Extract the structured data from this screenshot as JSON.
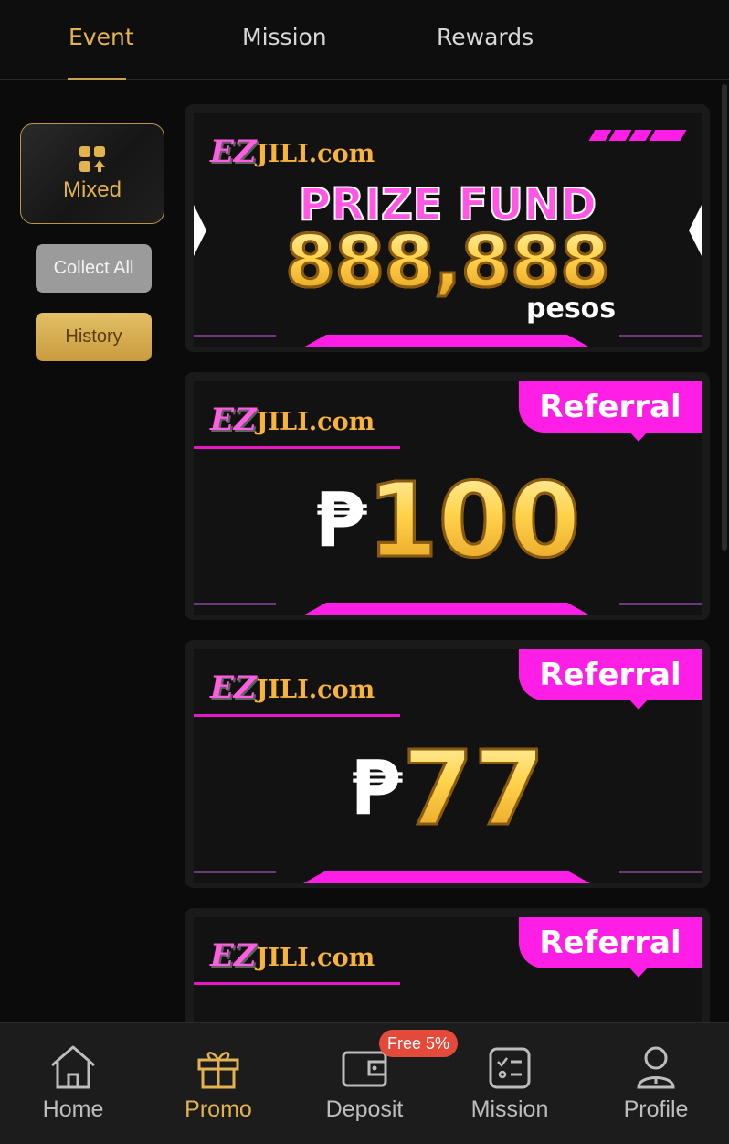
{
  "tabs": [
    {
      "label": "Event",
      "active": true
    },
    {
      "label": "Mission",
      "active": false
    },
    {
      "label": "Rewards",
      "active": false
    }
  ],
  "sidebar": {
    "filter_label": "Mixed",
    "filter_icon": "cards-suits-icon",
    "collect_all_label": "Collect All",
    "history_label": "History"
  },
  "cards": [
    {
      "type": "prize",
      "logo_ez": "EZ",
      "logo_rest": "JILI.com",
      "title": "PRIZE FUND",
      "amount": "888,888",
      "unit": "pesos"
    },
    {
      "type": "referral",
      "logo_ez": "EZ",
      "logo_rest": "JILI.com",
      "badge": "Referral",
      "currency": "₱",
      "amount": "100"
    },
    {
      "type": "referral",
      "logo_ez": "EZ",
      "logo_rest": "JILI.com",
      "badge": "Referral",
      "currency": "₱",
      "amount": "77"
    },
    {
      "type": "referral",
      "logo_ez": "EZ",
      "logo_rest": "JILI.com",
      "badge": "Referral"
    }
  ],
  "nav": {
    "items": [
      {
        "label": "Home",
        "icon": "home-icon",
        "active": false
      },
      {
        "label": "Promo",
        "icon": "gift-icon",
        "active": true
      },
      {
        "label": "Deposit",
        "icon": "wallet-icon",
        "active": false
      },
      {
        "label": "Mission",
        "icon": "checklist-icon",
        "active": false
      },
      {
        "label": "Profile",
        "icon": "user-icon",
        "active": false
      }
    ],
    "deposit_badge": "Free 5%"
  },
  "colors": {
    "accent_gold": "#e2b34e",
    "magenta": "#ff1ee6",
    "background": "#0b0b0b",
    "badge_red": "#e44a3a"
  }
}
